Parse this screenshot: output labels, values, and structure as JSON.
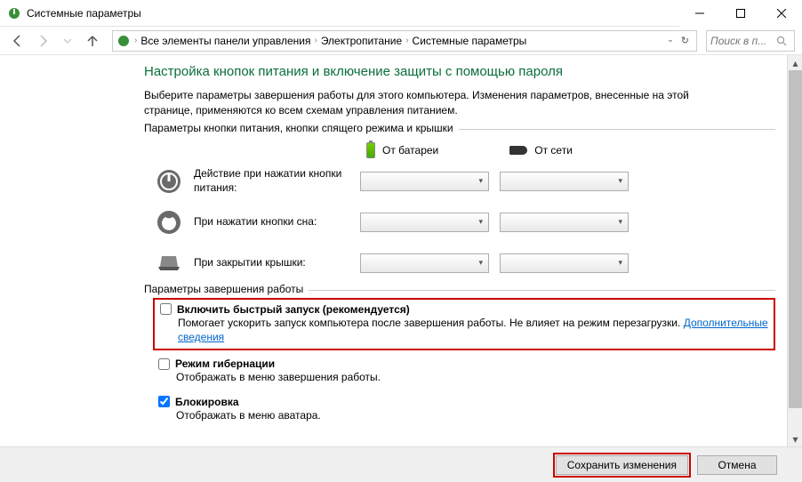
{
  "titlebar": {
    "title": "Системные параметры"
  },
  "breadcrumbs": {
    "items": [
      "Все элементы панели управления",
      "Электропитание",
      "Системные параметры"
    ]
  },
  "search": {
    "placeholder": "Поиск в п..."
  },
  "page": {
    "title": "Настройка кнопок питания и включение защиты с помощью пароля",
    "intro": "Выберите параметры завершения работы для этого компьютера. Изменения параметров, внесенные на этой странице, применяются ко всем схемам управления питанием."
  },
  "button_group": {
    "legend": "Параметры кнопки питания, кнопки спящего режима и крышки",
    "sources": {
      "battery": "От батареи",
      "ac": "От сети"
    },
    "rows": [
      {
        "label": "Действие при нажатии кнопки питания:"
      },
      {
        "label": "При нажатии кнопки сна:"
      },
      {
        "label": "При закрытии крышки:"
      }
    ]
  },
  "shutdown_group": {
    "legend": "Параметры завершения работы",
    "options": [
      {
        "checked": false,
        "title": "Включить быстрый запуск (рекомендуется)",
        "desc_pre": "Помогает ускорить запуск компьютера после завершения работы. Не влияет на режим перезагрузки. ",
        "link": "Дополнительные сведения",
        "highlight": true
      },
      {
        "checked": false,
        "title": "Режим гибернации",
        "desc": "Отображать в меню завершения работы."
      },
      {
        "checked": true,
        "title": "Блокировка",
        "desc": "Отображать в меню аватара."
      }
    ]
  },
  "footer": {
    "save": "Сохранить изменения",
    "cancel": "Отмена"
  }
}
